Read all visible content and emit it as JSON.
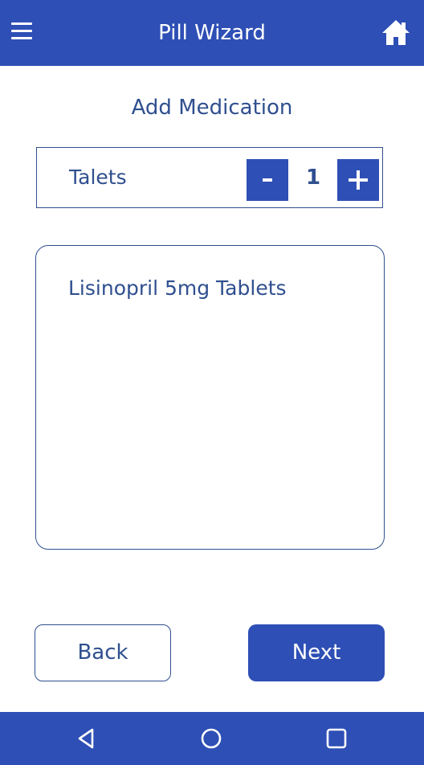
{
  "header": {
    "title": "Pill Wizard",
    "menu_icon": "hamburger-menu-icon",
    "home_icon": "home-icon"
  },
  "page": {
    "heading": "Add Medication"
  },
  "quantity": {
    "unit_label": "Talets",
    "value": "1",
    "decrement_icon": "minus-icon",
    "increment_icon": "plus-icon"
  },
  "medication": {
    "name": "Lisinopril 5mg Tablets"
  },
  "actions": {
    "back_label": "Back",
    "next_label": "Next"
  },
  "system_nav": {
    "back_icon": "triangle-back-icon",
    "home_icon": "circle-home-icon",
    "recents_icon": "square-recents-icon"
  },
  "colors": {
    "primary": "#2e4fb5",
    "text": "#2f4f8f",
    "background": "#ffffff"
  }
}
